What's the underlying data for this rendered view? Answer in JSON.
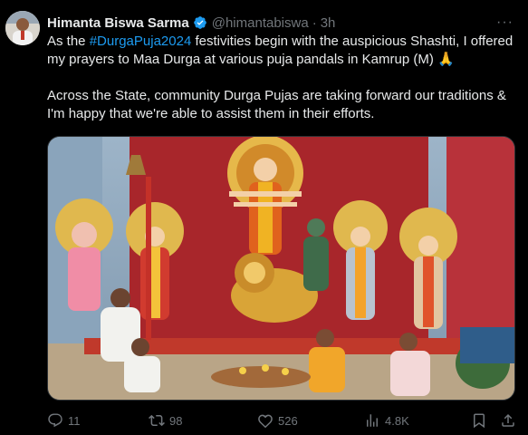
{
  "tweet": {
    "author_name": "Himanta Biswa Sarma",
    "handle": "@himantabiswa",
    "separator": "·",
    "time": "3h",
    "more_label": "···",
    "text_line1_pre": "As the ",
    "hashtag": "#DurgaPuja2024",
    "text_line1_post": " festivities begin with the auspicious Shashti, I offered my prayers to Maa Durga at various puja pandals in Kamrup (M) 🙏",
    "text_para2": "Across the State, community Durga Pujas are taking forward our traditions & I'm happy that we're able to assist them in their efforts."
  },
  "actions": {
    "replies": "11",
    "reposts": "98",
    "likes": "526",
    "views": "4.8K"
  },
  "colors": {
    "background": "#000000",
    "text": "#e7e9ea",
    "muted": "#71767b",
    "link": "#1d9bf0",
    "verified": "#1d9bf0"
  }
}
